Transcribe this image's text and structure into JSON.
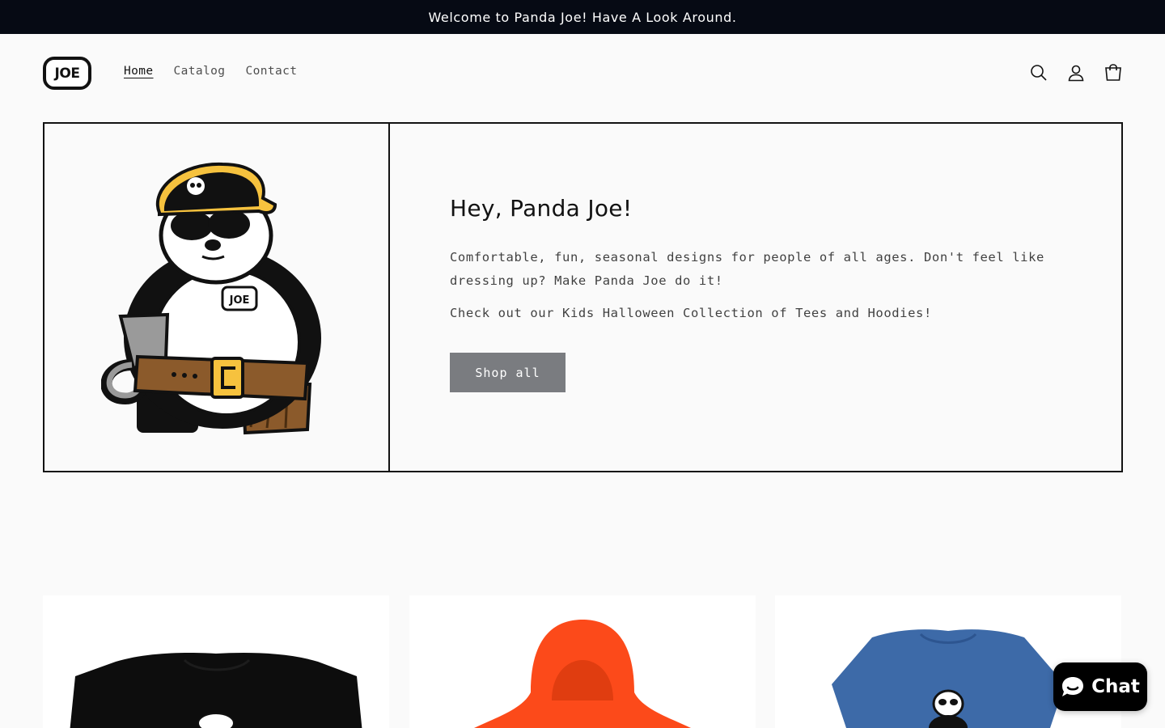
{
  "announcement": {
    "text": "Welcome to Panda Joe! Have A Look Around."
  },
  "header": {
    "logo_text": "JOE",
    "nav": [
      {
        "label": "Home",
        "active": true
      },
      {
        "label": "Catalog",
        "active": false
      },
      {
        "label": "Contact",
        "active": false
      }
    ],
    "icons": [
      "search-icon",
      "account-icon",
      "cart-icon"
    ]
  },
  "hero": {
    "image_badge": "JOE",
    "title": "Hey, Panda Joe!",
    "text_1": "Comfortable, fun, seasonal designs for people of all ages. Don't feel like dressing up? Make Panda Joe do it!",
    "text_2": "Check out our Kids Halloween Collection of Tees and Hoodies!",
    "button_label": "Shop all"
  },
  "products": [
    {
      "image": "black-tshirt",
      "color": "#0d0d0d"
    },
    {
      "image": "orange-hoodie",
      "color": "#fc4a1a"
    },
    {
      "image": "blue-tshirt",
      "color": "#3d6aa8"
    }
  ],
  "chat": {
    "label": "Chat"
  }
}
